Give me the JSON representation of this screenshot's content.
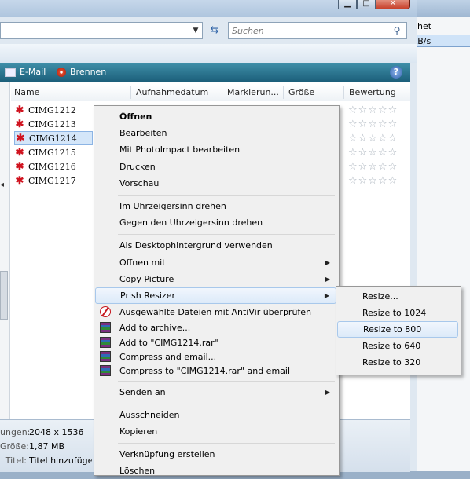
{
  "colors": {
    "toolbar": "#2a7490",
    "selection": "#d4e6f9",
    "menu_bg": "#f0f0f0"
  },
  "background_window": {
    "row1": "ghet",
    "row2": "KB/s"
  },
  "window": {
    "caption_buttons": [
      "minimize",
      "maximize",
      "close"
    ],
    "search_placeholder": "Suchen",
    "search_icon": "magnifier-icon"
  },
  "toolbar": {
    "email": "E-Mail",
    "burn": "Brennen",
    "help": "?"
  },
  "columns": [
    "Name",
    "Aufnahmedatum",
    "Markierun...",
    "Größe",
    "Bewertung"
  ],
  "files": [
    {
      "name": "CIMG1212",
      "rating": 0
    },
    {
      "name": "CIMG1213",
      "rating": 0
    },
    {
      "name": "CIMG1214",
      "rating": 0,
      "selected": true
    },
    {
      "name": "CIMG1215",
      "rating": 0
    },
    {
      "name": "CIMG1216",
      "rating": 0
    },
    {
      "name": "CIMG1217",
      "rating": 0
    }
  ],
  "details": {
    "row1_label": "ungen:",
    "row1_value": "2048 x 1536",
    "row2_label": "Größe:",
    "row2_value": "1,87 MB",
    "row3_label": "Titel:",
    "row3_value": "Titel hinzufügen"
  },
  "context_menu": {
    "open": "Öffnen",
    "edit": "Bearbeiten",
    "photoimpact": "Mit PhotoImpact bearbeiten",
    "print": "Drucken",
    "preview": "Vorschau",
    "rotate_cw": "Im Uhrzeigersinn drehen",
    "rotate_ccw": "Gegen den Uhrzeigersinn drehen",
    "desktop_bg": "Als Desktophintergrund verwenden",
    "open_with": "Öffnen mit",
    "copy_picture": "Copy Picture",
    "prish_resizer": "Prish Resizer",
    "antivir": "Ausgewählte Dateien mit AntiVir überprüfen",
    "add_archive": "Add to archive...",
    "add_rar": "Add to \"CIMG1214.rar\"",
    "compress_email": "Compress and email...",
    "compress_rar_email": "Compress to \"CIMG1214.rar\" and email",
    "send_to": "Senden an",
    "cut": "Ausschneiden",
    "copy": "Kopieren",
    "shortcut": "Verknüpfung erstellen",
    "delete": "Löschen"
  },
  "submenu": {
    "resize": "Resize...",
    "r1024": "Resize to 1024",
    "r800": "Resize to 800",
    "r640": "Resize to 640",
    "r320": "Resize to 320"
  }
}
